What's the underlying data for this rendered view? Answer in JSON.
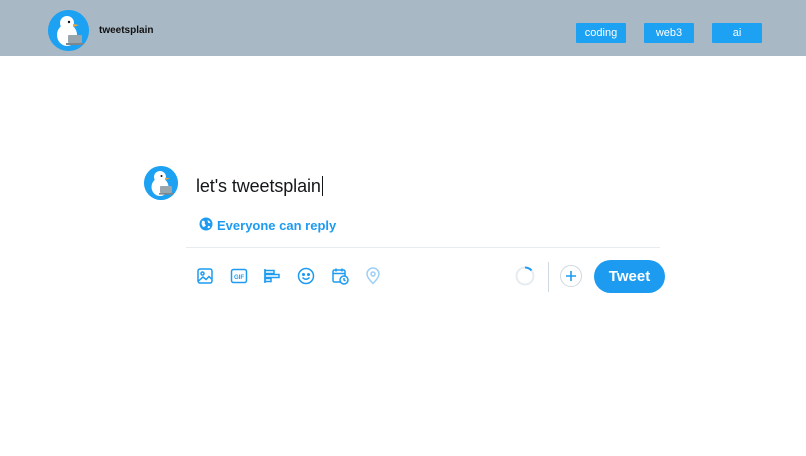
{
  "header": {
    "brand": "tweetsplain",
    "logo_icon": "duck-with-laptop-icon",
    "nav": [
      "coding",
      "web3",
      "ai"
    ]
  },
  "composer": {
    "avatar_icon": "duck-with-laptop-icon",
    "text": "let's tweetsplain",
    "reply_setting": "Everyone can reply",
    "reply_icon": "globe-icon",
    "tools": [
      "image-icon",
      "gif-icon",
      "poll-icon",
      "emoji-icon",
      "schedule-icon",
      "location-icon"
    ],
    "submit_label": "Tweet"
  },
  "colors": {
    "header_bg": "#a8b8c4",
    "accent": "#1d9bf0",
    "nav_button": "#1da1f2"
  }
}
